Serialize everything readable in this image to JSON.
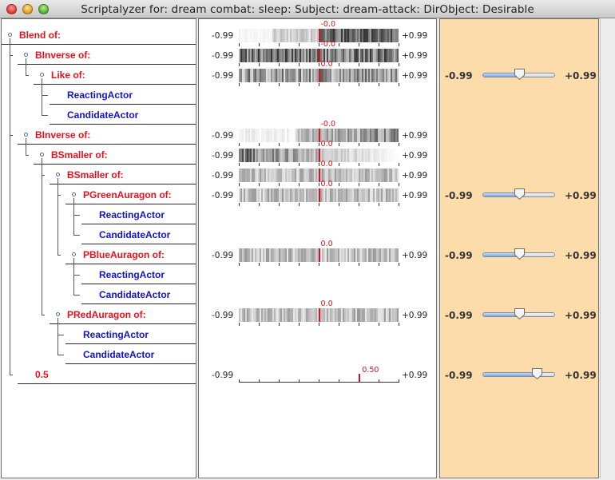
{
  "window": {
    "title": "Scriptalyzer for: dream combat: sleep: Subject: dream-attack: DirObject: Desirable"
  },
  "tree": [
    {
      "label": "Blend of:",
      "kind": "op",
      "depth": 0
    },
    {
      "label": "BInverse of:",
      "kind": "op",
      "depth": 1
    },
    {
      "label": "Like of:",
      "kind": "op",
      "depth": 2
    },
    {
      "label": "ReactingActor",
      "kind": "leaf",
      "depth": 3
    },
    {
      "label": "CandidateActor",
      "kind": "leaf",
      "depth": 3
    },
    {
      "label": "BInverse of:",
      "kind": "op",
      "depth": 1
    },
    {
      "label": "BSmaller of:",
      "kind": "op",
      "depth": 2
    },
    {
      "label": "BSmaller of:",
      "kind": "op",
      "depth": 3
    },
    {
      "label": "PGreenAuragon of:",
      "kind": "op",
      "depth": 4
    },
    {
      "label": "ReactingActor",
      "kind": "leaf",
      "depth": 5
    },
    {
      "label": "CandidateActor",
      "kind": "leaf",
      "depth": 5
    },
    {
      "label": "PBlueAuragon of:",
      "kind": "op",
      "depth": 4
    },
    {
      "label": "ReactingActor",
      "kind": "leaf",
      "depth": 5
    },
    {
      "label": "CandidateActor",
      "kind": "leaf",
      "depth": 5
    },
    {
      "label": "PRedAuragon of:",
      "kind": "op",
      "depth": 3
    },
    {
      "label": "ReactingActor",
      "kind": "leaf",
      "depth": 4
    },
    {
      "label": "CandidateActor",
      "kind": "leaf",
      "depth": 4
    },
    {
      "label": "0.5",
      "kind": "op",
      "depth": 1
    }
  ],
  "bars": [
    {
      "row": 0,
      "min": "-0.99",
      "max": "+0.99",
      "value_label": "-0.0",
      "value": 0.0,
      "pattern": "dark-right"
    },
    {
      "row": 1,
      "min": "-0.99",
      "max": "+0.99",
      "value_label": "-0.0",
      "value": 0.0,
      "pattern": "mixed-dark"
    },
    {
      "row": 2,
      "min": "-0.99",
      "max": "+0.99",
      "value_label": "0.0",
      "value": 0.0,
      "pattern": "mixed"
    },
    {
      "row": 5,
      "min": "-0.99",
      "max": "+0.99",
      "value_label": "-0.0",
      "value": 0.0,
      "pattern": "light-left"
    },
    {
      "row": 6,
      "min": "-0.99",
      "max": "+0.99",
      "value_label": "0.0",
      "value": 0.0,
      "pattern": "dark-left"
    },
    {
      "row": 7,
      "min": "-0.99",
      "max": "+0.99",
      "value_label": "0.0",
      "value": 0.0,
      "pattern": "mixed-light"
    },
    {
      "row": 8,
      "min": "-0.99",
      "max": "+0.99",
      "value_label": "0.0",
      "value": 0.0,
      "pattern": "mixed-light"
    },
    {
      "row": 11,
      "min": "-0.99",
      "max": "+0.99",
      "value_label": "0.0",
      "value": 0.0,
      "pattern": "mixed-light"
    },
    {
      "row": 14,
      "min": "-0.99",
      "max": "+0.99",
      "value_label": "0.0",
      "value": 0.0,
      "pattern": "mixed-light"
    },
    {
      "row": 17,
      "min": "-0.99",
      "max": "+0.99",
      "value_label": "0.50",
      "value": 0.5,
      "pattern": "axis"
    }
  ],
  "sliders": [
    {
      "row": 2,
      "min": "-0.99",
      "max": "+0.99",
      "value": 0.0
    },
    {
      "row": 8,
      "min": "-0.99",
      "max": "+0.99",
      "value": 0.0
    },
    {
      "row": 11,
      "min": "-0.99",
      "max": "+0.99",
      "value": 0.0
    },
    {
      "row": 14,
      "min": "-0.99",
      "max": "+0.99",
      "value": 0.0
    },
    {
      "row": 17,
      "min": "-0.99",
      "max": "+0.99",
      "value": 0.5
    }
  ],
  "colors": {
    "operator_text": "#e8121e",
    "leaf_text": "#1414c8",
    "marker": "#d6141b",
    "slider_panel_bg": "#fddcab"
  }
}
